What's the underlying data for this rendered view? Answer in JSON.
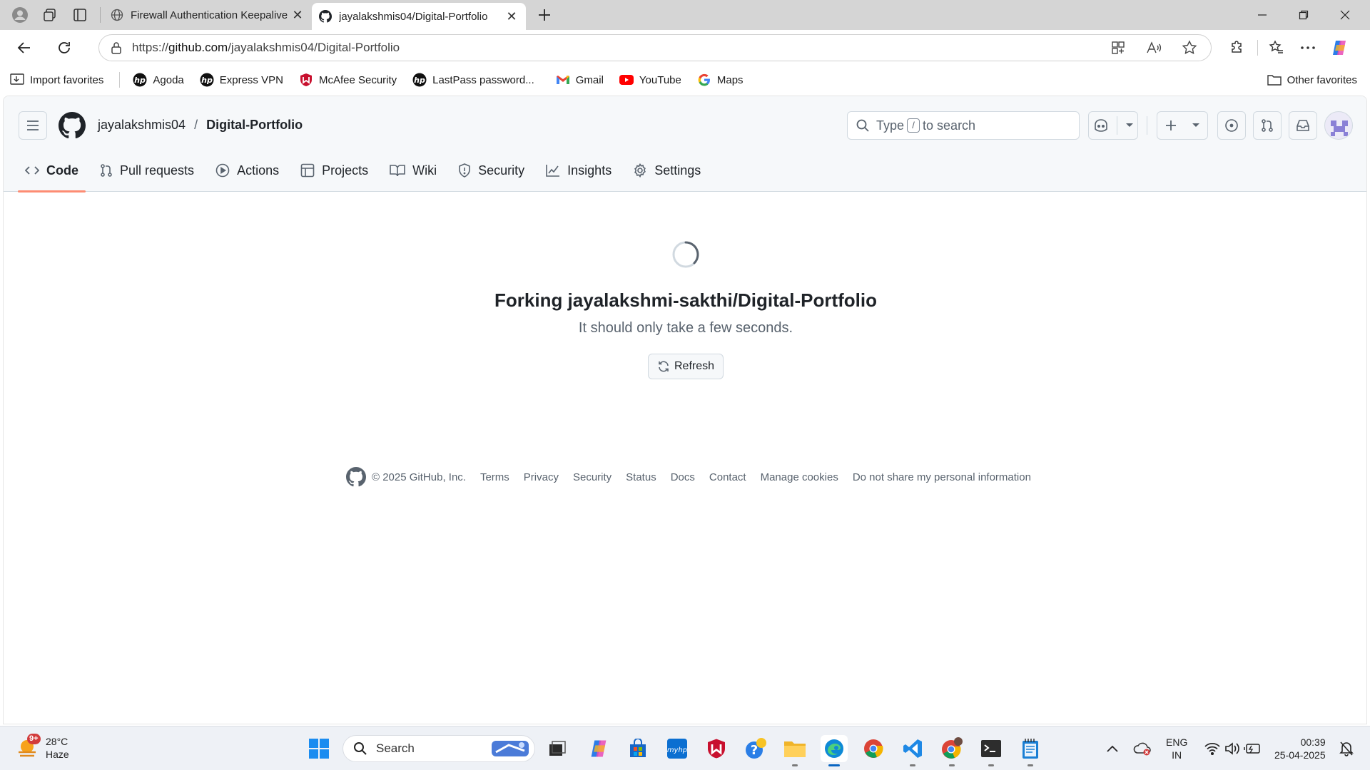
{
  "browser": {
    "tabs": [
      {
        "title": "Firewall Authentication Keepalive",
        "active": false
      },
      {
        "title": "jayalakshmis04/Digital-Portfolio",
        "active": true
      }
    ],
    "url_prefix": "https://",
    "url_domain": "github.com",
    "url_path": "/jayalakshmis04/Digital-Portfolio",
    "favorites": [
      {
        "label": "Import favorites",
        "icon": "import-icon"
      },
      {
        "label": "Agoda",
        "icon": "hp-icon"
      },
      {
        "label": "Express VPN",
        "icon": "hp-icon"
      },
      {
        "label": "McAfee Security",
        "icon": "mcafee-icon"
      },
      {
        "label": "LastPass password...",
        "icon": "hp-icon"
      },
      {
        "label": "Gmail",
        "icon": "gmail-icon"
      },
      {
        "label": "YouTube",
        "icon": "youtube-icon"
      },
      {
        "label": "Maps",
        "icon": "google-icon"
      }
    ],
    "other_favorites": "Other favorites"
  },
  "github": {
    "owner": "jayalakshmis04",
    "separator": "/",
    "repo": "Digital-Portfolio",
    "search_prefix": "Type",
    "search_key": "/",
    "search_suffix": "to search",
    "repo_tabs": [
      {
        "label": "Code",
        "icon": "code-icon",
        "selected": true
      },
      {
        "label": "Pull requests",
        "icon": "pull-request-icon",
        "selected": false
      },
      {
        "label": "Actions",
        "icon": "play-icon",
        "selected": false
      },
      {
        "label": "Projects",
        "icon": "table-icon",
        "selected": false
      },
      {
        "label": "Wiki",
        "icon": "book-icon",
        "selected": false
      },
      {
        "label": "Security",
        "icon": "shield-icon",
        "selected": false
      },
      {
        "label": "Insights",
        "icon": "graph-icon",
        "selected": false
      },
      {
        "label": "Settings",
        "icon": "gear-icon",
        "selected": false
      }
    ],
    "fork_title": "Forking jayalakshmi-sakthi/Digital-Portfolio",
    "fork_subtitle": "It should only take a few seconds.",
    "refresh_label": "Refresh",
    "footer": {
      "copyright": "© 2025 GitHub, Inc.",
      "links": [
        "Terms",
        "Privacy",
        "Security",
        "Status",
        "Docs",
        "Contact",
        "Manage cookies",
        "Do not share my personal information"
      ]
    }
  },
  "taskbar": {
    "weather_temp": "28°C",
    "weather_desc": "Haze",
    "weather_badge": "9+",
    "search_label": "Search",
    "lang_line1": "ENG",
    "lang_line2": "IN",
    "time": "00:39",
    "date": "25-04-2025"
  },
  "colors": {
    "accent_underline": "#fd8c73",
    "github_header_bg": "#f6f8fa",
    "taskbar_bg": "#eef1f6"
  }
}
